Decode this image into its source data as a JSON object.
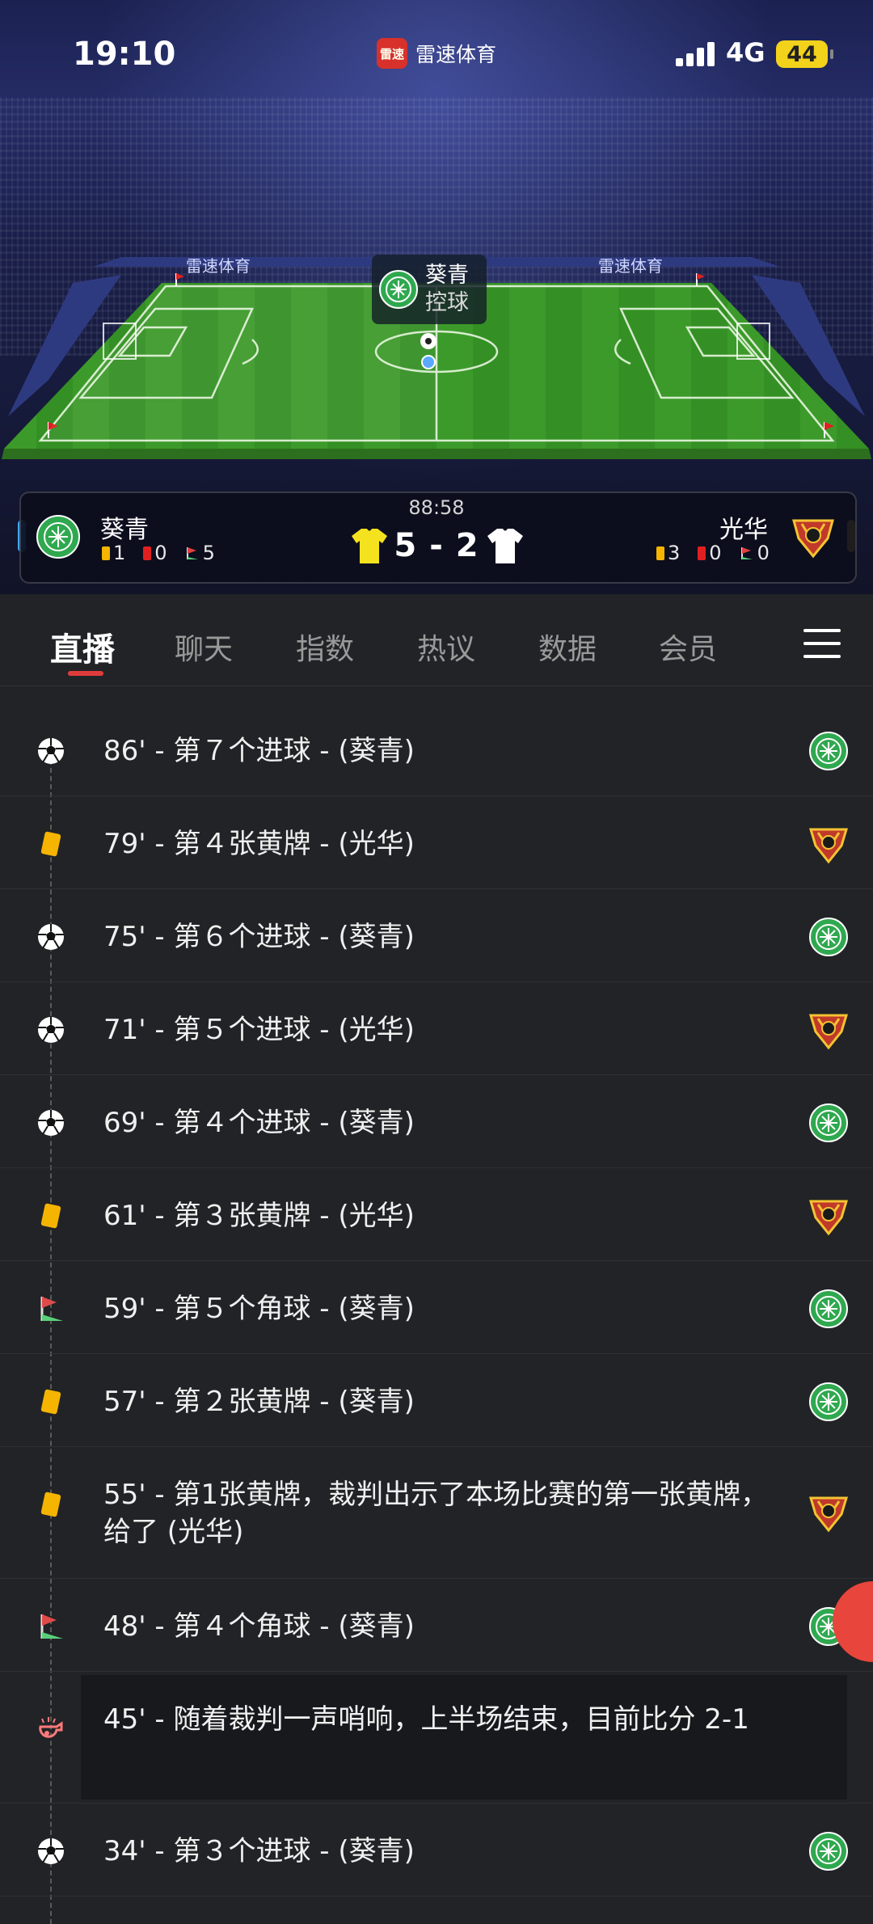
{
  "status_bar": {
    "time": "19:10",
    "app_name": "雷速体育",
    "app_icon_text": "雷速",
    "network": "4G",
    "battery": "44"
  },
  "stadium": {
    "board_text_left": "雷速体育",
    "board_text_right": "雷速体育",
    "possession_team": "葵青",
    "possession_label": "控球"
  },
  "match": {
    "clock": "88:58",
    "home": {
      "name": "葵青",
      "yellow": "1",
      "red": "0",
      "corners": "5",
      "color": "#2fa84f",
      "shirt_color": "#f5e21e"
    },
    "away": {
      "name": "光华",
      "yellow": "3",
      "red": "0",
      "corners": "0",
      "color": "#c0392b",
      "shirt_color": "#ffffff"
    },
    "score_home": "5",
    "score_away": "2",
    "score_sep": "-"
  },
  "tabs": [
    {
      "label": "直播",
      "active": true
    },
    {
      "label": "聊天",
      "active": false
    },
    {
      "label": "指数",
      "active": false
    },
    {
      "label": "热议",
      "active": false
    },
    {
      "label": "数据",
      "active": false
    },
    {
      "label": "会员",
      "active": false
    }
  ],
  "events": [
    {
      "icon": "soccer-ball-icon",
      "text": "86' - 第７个进球 - (葵青)",
      "team": "home"
    },
    {
      "icon": "yellow-card-icon",
      "text": "79' - 第４张黄牌 - (光华)",
      "team": "away"
    },
    {
      "icon": "soccer-ball-icon",
      "text": "75' - 第６个进球 - (葵青)",
      "team": "home"
    },
    {
      "icon": "soccer-ball-icon",
      "text": "71' - 第５个进球 - (光华)",
      "team": "away"
    },
    {
      "icon": "soccer-ball-icon",
      "text": "69' - 第４个进球 - (葵青)",
      "team": "home"
    },
    {
      "icon": "yellow-card-icon",
      "text": "61' - 第３张黄牌 - (光华)",
      "team": "away"
    },
    {
      "icon": "corner-flag-icon",
      "text": "59' - 第５个角球 - (葵青)",
      "team": "home"
    },
    {
      "icon": "yellow-card-icon",
      "text": "57' - 第２张黄牌 - (葵青)",
      "team": "home"
    },
    {
      "icon": "yellow-card-icon",
      "text": "55' - 第1张黄牌，裁判出示了本场比赛的第一张黄牌，给了 (光华)",
      "team": "away"
    },
    {
      "icon": "corner-flag-icon",
      "text": "48' - 第４个角球 - (葵青)",
      "team": "home"
    },
    {
      "icon": "whistle-icon",
      "text": "45' - 随着裁判一声哨响，上半场结束，目前比分 2-1",
      "team": ""
    },
    {
      "icon": "soccer-ball-icon",
      "text": "34' - 第３个进球 - (葵青)",
      "team": "home"
    }
  ],
  "colors": {
    "accent": "#e03c3c",
    "background": "#222326",
    "yellow_card": "#f5b400",
    "pitch_green": "#3f9a2c"
  }
}
